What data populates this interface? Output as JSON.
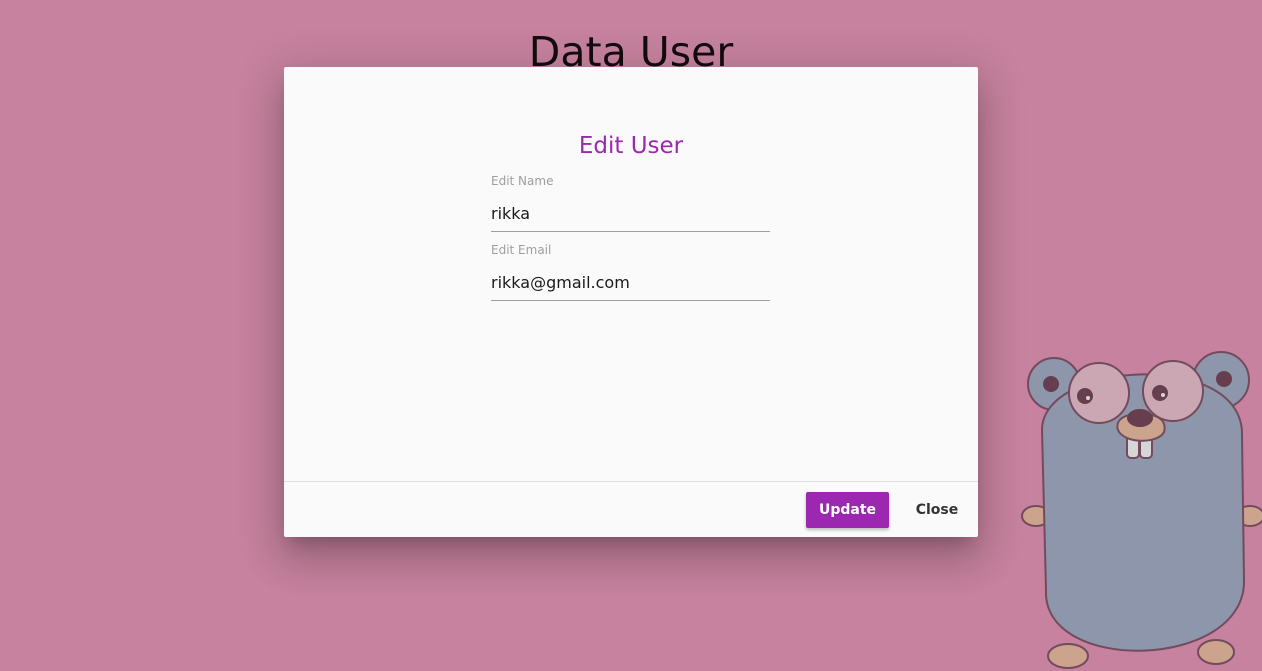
{
  "page": {
    "title": "Data User",
    "background_color": "#ec9bbd"
  },
  "mascot": {
    "name": "gopher-icon",
    "body_color": "#a9b3cc"
  },
  "modal": {
    "title": "Edit User",
    "title_color": "#9c27b0",
    "fields": {
      "name": {
        "label": "Edit Name",
        "value": "rikka"
      },
      "email": {
        "label": "Edit Email",
        "value": "rikka@gmail.com"
      }
    },
    "footer": {
      "update_label": "Update",
      "close_label": "Close",
      "accent_color": "#9c27b0"
    }
  }
}
